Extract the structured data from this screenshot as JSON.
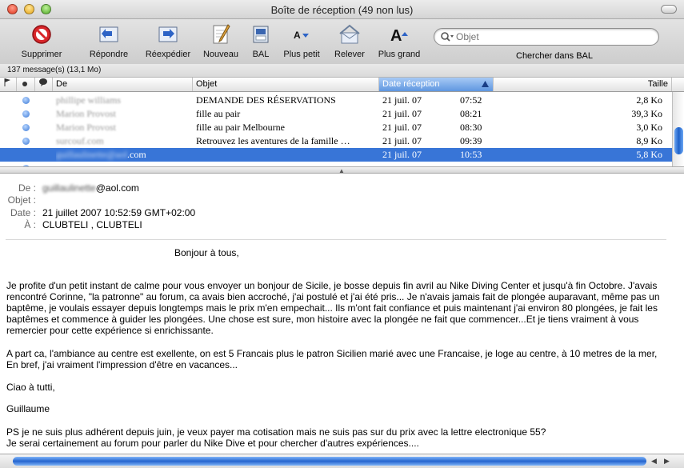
{
  "window": {
    "title": "Boîte de réception (49 non lus)"
  },
  "toolbar": {
    "delete": "Supprimer",
    "reply": "Répondre",
    "forward": "Réexpédier",
    "new": "Nouveau",
    "mailbox": "BAL",
    "smaller": "Plus petit",
    "fetch": "Relever",
    "bigger": "Plus grand",
    "search_placeholder": "Objet",
    "search_label": "Chercher dans BAL"
  },
  "status": {
    "count": "137 message(s) (13,1 Mo)"
  },
  "columns": {
    "from": "De",
    "subject": "Objet",
    "date": "Date réception",
    "size": "Taille"
  },
  "messages": [
    {
      "from": "phillipe williams",
      "subject": "DEMANDE  DES RÉSERVATIONS",
      "date": "21 juil. 07",
      "time": "07:52",
      "size": "2,8 Ko"
    },
    {
      "from": "Marion Provost",
      "subject": "fille au pair",
      "date": "21 juil. 07",
      "time": "08:21",
      "size": "39,3 Ko"
    },
    {
      "from": "Marion Provost",
      "subject": "fille au pair Melbourne",
      "date": "21 juil. 07",
      "time": "08:30",
      "size": "3,0 Ko"
    },
    {
      "from": "surcouf.com",
      "subject": "Retrouvez les aventures de la famille …",
      "date": "21 juil. 07",
      "time": "09:39",
      "size": "8,9 Ko"
    },
    {
      "from_hidden": "guillaulinette@aol",
      "from_visible": ".com",
      "subject": "",
      "date": "21 juil. 07",
      "time": "10:53",
      "size": "5,8 Ko"
    }
  ],
  "message": {
    "from_label": "De :",
    "from_user": "guillaulinette",
    "from_domain": "@aol.com",
    "subject_label": "Objet :",
    "date_label": "Date :",
    "date": "21 juillet 2007 10:52:59 GMT+02:00",
    "to_label": "À :",
    "to": "CLUBTELI ,  CLUBTELI",
    "greeting": "Bonjour à tous,",
    "p1": "Je profite d'un petit instant de calme pour vous envoyer un bonjour de Sicile, je bosse depuis fin avril au Nike Diving Center et jusqu'à fin Octobre. J'avais rencontré Corinne, \"la patronne\" au forum, ca avais bien accroché, j'ai postulé et j'ai été pris... Je n'avais jamais fait de plongée auparavant, même pas un baptême, je voulais essayer depuis longtemps mais le prix m'en empechait... Ils m'ont fait confiance et puis maintenant j'ai environ 80 plongées, je fait les baptêmes et commence à guider les plongées. Une chose est sure, mon histoire avec la plongée ne fait que commencer...Et je tiens vraiment à vous remercier pour cette expérience si enrichissante.",
    "p2": " A part ca, l'ambiance au centre est exellente, on est 5 Francais plus le patron Sicilien marié avec une Francaise, je loge au centre, à 10 metres de la mer, En bref, j'ai vraiment l'impression d'être en vacances...",
    "p3": "Ciao à tutti,",
    "p4": "Guillaume",
    "p5a": "PS je ne suis plus adhérent depuis juin, je veux payer ma cotisation mais ne suis pas sur du prix avec la lettre electronique 55?",
    "p5b": "Je serai certainement au forum pour parler du Nike Dive et pour chercher d'autres expériences...."
  }
}
